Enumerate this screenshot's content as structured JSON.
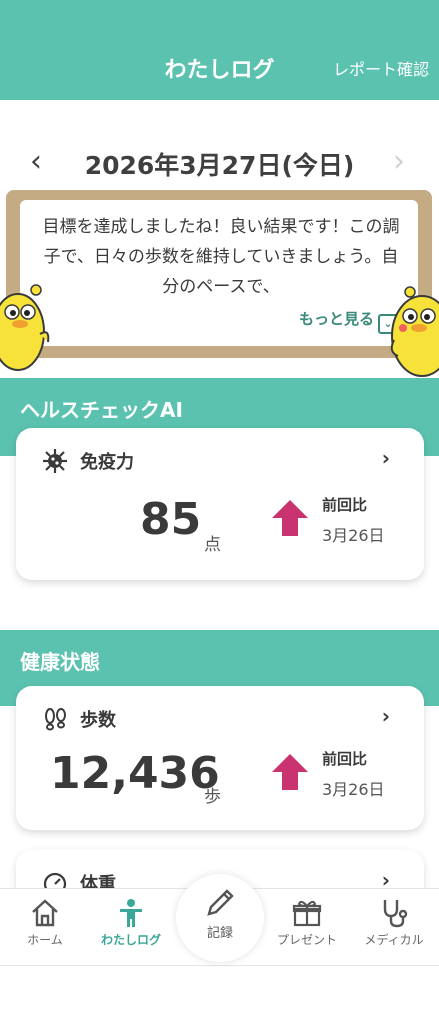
{
  "header": {
    "title": "わたしログ",
    "report_link": "レポート確認"
  },
  "date_nav": {
    "date": "2026年3月27日(今日)",
    "prev_icon": "chevron-left-icon",
    "next_icon": "chevron-right-icon"
  },
  "message_board": {
    "text": "目標を達成しましたね！良い結果です！この調子で、日々の歩数を維持していきましょう。自分のペースで、",
    "more_label": "もっと見る"
  },
  "health_check": {
    "section_title": "ヘルスチェックAI",
    "card": {
      "label": "免疫力",
      "value": "85",
      "unit": "点",
      "compare_label": "前回比",
      "compare_date": "3月26日"
    }
  },
  "health_status": {
    "section_title": "健康状態",
    "steps": {
      "label": "歩数",
      "value": "12,436",
      "unit": "歩",
      "compare_label": "前回比",
      "compare_date": "3月26日"
    },
    "weight": {
      "label": "体重"
    }
  },
  "tabbar": {
    "tabs": [
      {
        "label": "ホーム",
        "icon": "home-icon"
      },
      {
        "label": "わたしログ",
        "icon": "person-icon",
        "active": true
      },
      {
        "label": "記録",
        "icon": "pencil-icon"
      },
      {
        "label": "プレゼント",
        "icon": "gift-icon"
      },
      {
        "label": "メディカル",
        "icon": "stethoscope-icon"
      }
    ]
  },
  "colors": {
    "accent": "#5cc2b0",
    "up_arrow": "#c9336f",
    "board": "#c4ab84"
  }
}
